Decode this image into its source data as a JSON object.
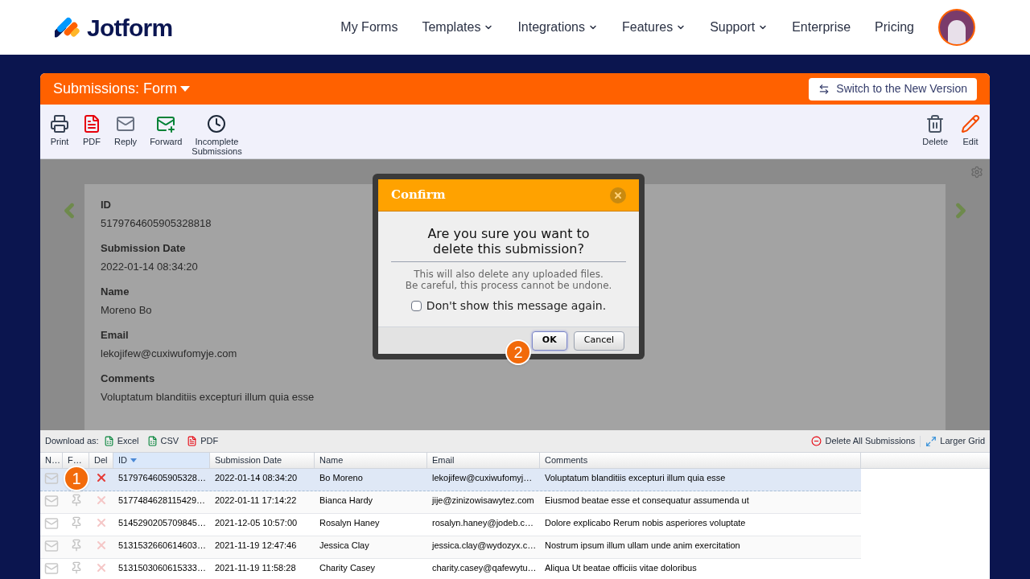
{
  "header": {
    "logo": "Jotform",
    "nav": [
      {
        "label": "My Forms",
        "dropdown": false
      },
      {
        "label": "Templates",
        "dropdown": true
      },
      {
        "label": "Integrations",
        "dropdown": true
      },
      {
        "label": "Features",
        "dropdown": true
      },
      {
        "label": "Support",
        "dropdown": true
      },
      {
        "label": "Enterprise",
        "dropdown": false
      },
      {
        "label": "Pricing",
        "dropdown": false
      }
    ]
  },
  "panel": {
    "title": "Submissions: Form",
    "switch_button": "Switch to the New Version"
  },
  "toolbar": {
    "left": [
      {
        "kind": "print",
        "label": "Print"
      },
      {
        "kind": "pdf",
        "label": "PDF"
      },
      {
        "kind": "reply",
        "label": "Reply"
      },
      {
        "kind": "forward",
        "label": "Forward"
      },
      {
        "kind": "clock",
        "label": "Incomplete Submissions"
      }
    ],
    "right": [
      {
        "kind": "trash",
        "label": "Delete"
      },
      {
        "kind": "edit",
        "label": "Edit"
      }
    ]
  },
  "detail": {
    "fields": [
      {
        "label": "ID",
        "value": "5179764605905328818"
      },
      {
        "label": "Submission Date",
        "value": "2022-01-14 08:34:20"
      },
      {
        "label": "Name",
        "value": "Moreno Bo"
      },
      {
        "label": "Email",
        "value": "lekojifew@cuxiwufomyje.com"
      },
      {
        "label": "Comments",
        "value": "Voluptatum blanditiis excepturi illum quia esse"
      }
    ]
  },
  "dialog": {
    "title": "Confirm",
    "question": "Are you sure you want to\ndelete this submission?",
    "note": "This will also delete any uploaded files.\nBe careful, this process cannot be undone.",
    "checkbox": {
      "label": "Don't show this message again.",
      "checked": false
    },
    "buttons": [
      {
        "label": "OK",
        "focused": true
      },
      {
        "label": "Cancel",
        "focused": false
      }
    ]
  },
  "grid": {
    "download_label": "Download as:",
    "downloads": [
      {
        "kind": "excel",
        "label": "Excel"
      },
      {
        "kind": "csv",
        "label": "CSV"
      },
      {
        "kind": "pdf",
        "label": "PDF"
      }
    ],
    "delete_all": "Delete All Submissions",
    "larger_grid": "Larger Grid",
    "columns": [
      {
        "label": "N…",
        "sorted": false
      },
      {
        "label": "F…",
        "sorted": false
      },
      {
        "label": "Del",
        "sorted": false
      },
      {
        "label": "ID",
        "sorted": true
      },
      {
        "label": "Submission Date",
        "sorted": false
      },
      {
        "label": "Name",
        "sorted": false
      },
      {
        "label": "Email",
        "sorted": false
      },
      {
        "label": "Comments",
        "sorted": false
      }
    ],
    "rows": [
      {
        "selected": true,
        "cells": [
          "",
          "",
          "",
          "5179764605905328…",
          "2022-01-14 08:34:20",
          "Bo Moreno",
          "lekojifew@cuxiwufomyj…",
          "Voluptatum blanditiis excepturi illum quia esse"
        ]
      },
      {
        "selected": false,
        "cells": [
          "",
          "",
          "",
          "5177484628115429…",
          "2022-01-11 17:14:22",
          "Bianca Hardy",
          "jije@zinizowisawytez.com",
          "Eiusmod beatae esse et consequatur assumenda ut"
        ]
      },
      {
        "selected": false,
        "cells": [
          "",
          "",
          "",
          "5145290205709845…",
          "2021-12-05 10:57:00",
          "Rosalyn Haney",
          "rosalyn.haney@jodeb.c…",
          "Dolore explicabo Rerum nobis asperiores voluptate"
        ]
      },
      {
        "selected": false,
        "cells": [
          "",
          "",
          "",
          "5131532660614603…",
          "2021-11-19 12:47:46",
          "Jessica Clay",
          "jessica.clay@wydozyx.c…",
          "Nostrum ipsum illum ullam unde anim exercitation"
        ]
      },
      {
        "selected": false,
        "cells": [
          "",
          "",
          "",
          "5131503060615333…",
          "2021-11-19 11:58:28",
          "Charity Casey",
          "charity.casey@qafewytu…",
          "Aliqua Ut beatae officiis vitae doloribus"
        ]
      }
    ]
  },
  "steps": [
    "1",
    "2"
  ]
}
